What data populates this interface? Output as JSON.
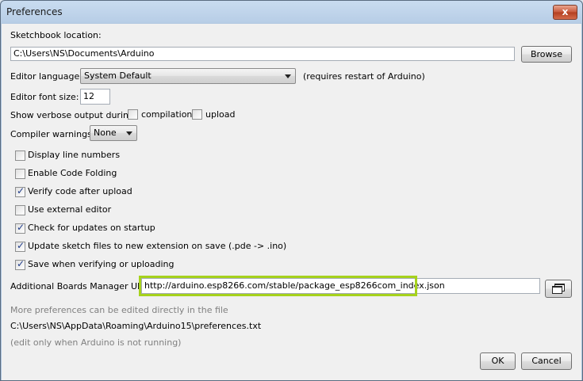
{
  "window": {
    "title": "Preferences",
    "close_glyph": "x"
  },
  "sketchbook": {
    "label": "Sketchbook location:",
    "path": "C:\\Users\\NS\\Documents\\Arduino",
    "browse_label": "Browse"
  },
  "editor_language": {
    "label": "Editor language:",
    "value": "System Default",
    "note": "(requires restart of Arduino)"
  },
  "font_size": {
    "label": "Editor font size:",
    "value": "12"
  },
  "verbose": {
    "label": "Show verbose output during:",
    "compilation_label": "compilation",
    "compilation_checked": false,
    "upload_label": "upload",
    "upload_checked": false
  },
  "compiler_warnings": {
    "label": "Compiler warnings:",
    "value": "None"
  },
  "options": [
    {
      "label": "Display line numbers",
      "checked": false
    },
    {
      "label": "Enable Code Folding",
      "checked": false
    },
    {
      "label": "Verify code after upload",
      "checked": true
    },
    {
      "label": "Use external editor",
      "checked": false
    },
    {
      "label": "Check for updates on startup",
      "checked": true
    },
    {
      "label": "Update sketch files to new extension on save (.pde -> .ino)",
      "checked": true
    },
    {
      "label": "Save when verifying or uploading",
      "checked": true
    }
  ],
  "boards_urls": {
    "label": "Additional Boards Manager URLs:",
    "value": "http://arduino.esp8266.com/stable/package_esp8266com_index.json"
  },
  "more_prefs": {
    "note": "More preferences can be edited directly in the file",
    "path": "C:\\Users\\NS\\AppData\\Roaming\\Arduino15\\preferences.txt",
    "edit_note": "(edit only when Arduino is not running)"
  },
  "buttons": {
    "ok_label": "OK",
    "cancel_label": "Cancel"
  },
  "colors": {
    "highlight": "#a6d21c",
    "titlebar": "#b9cfe8",
    "check": "#1f3c8a"
  }
}
